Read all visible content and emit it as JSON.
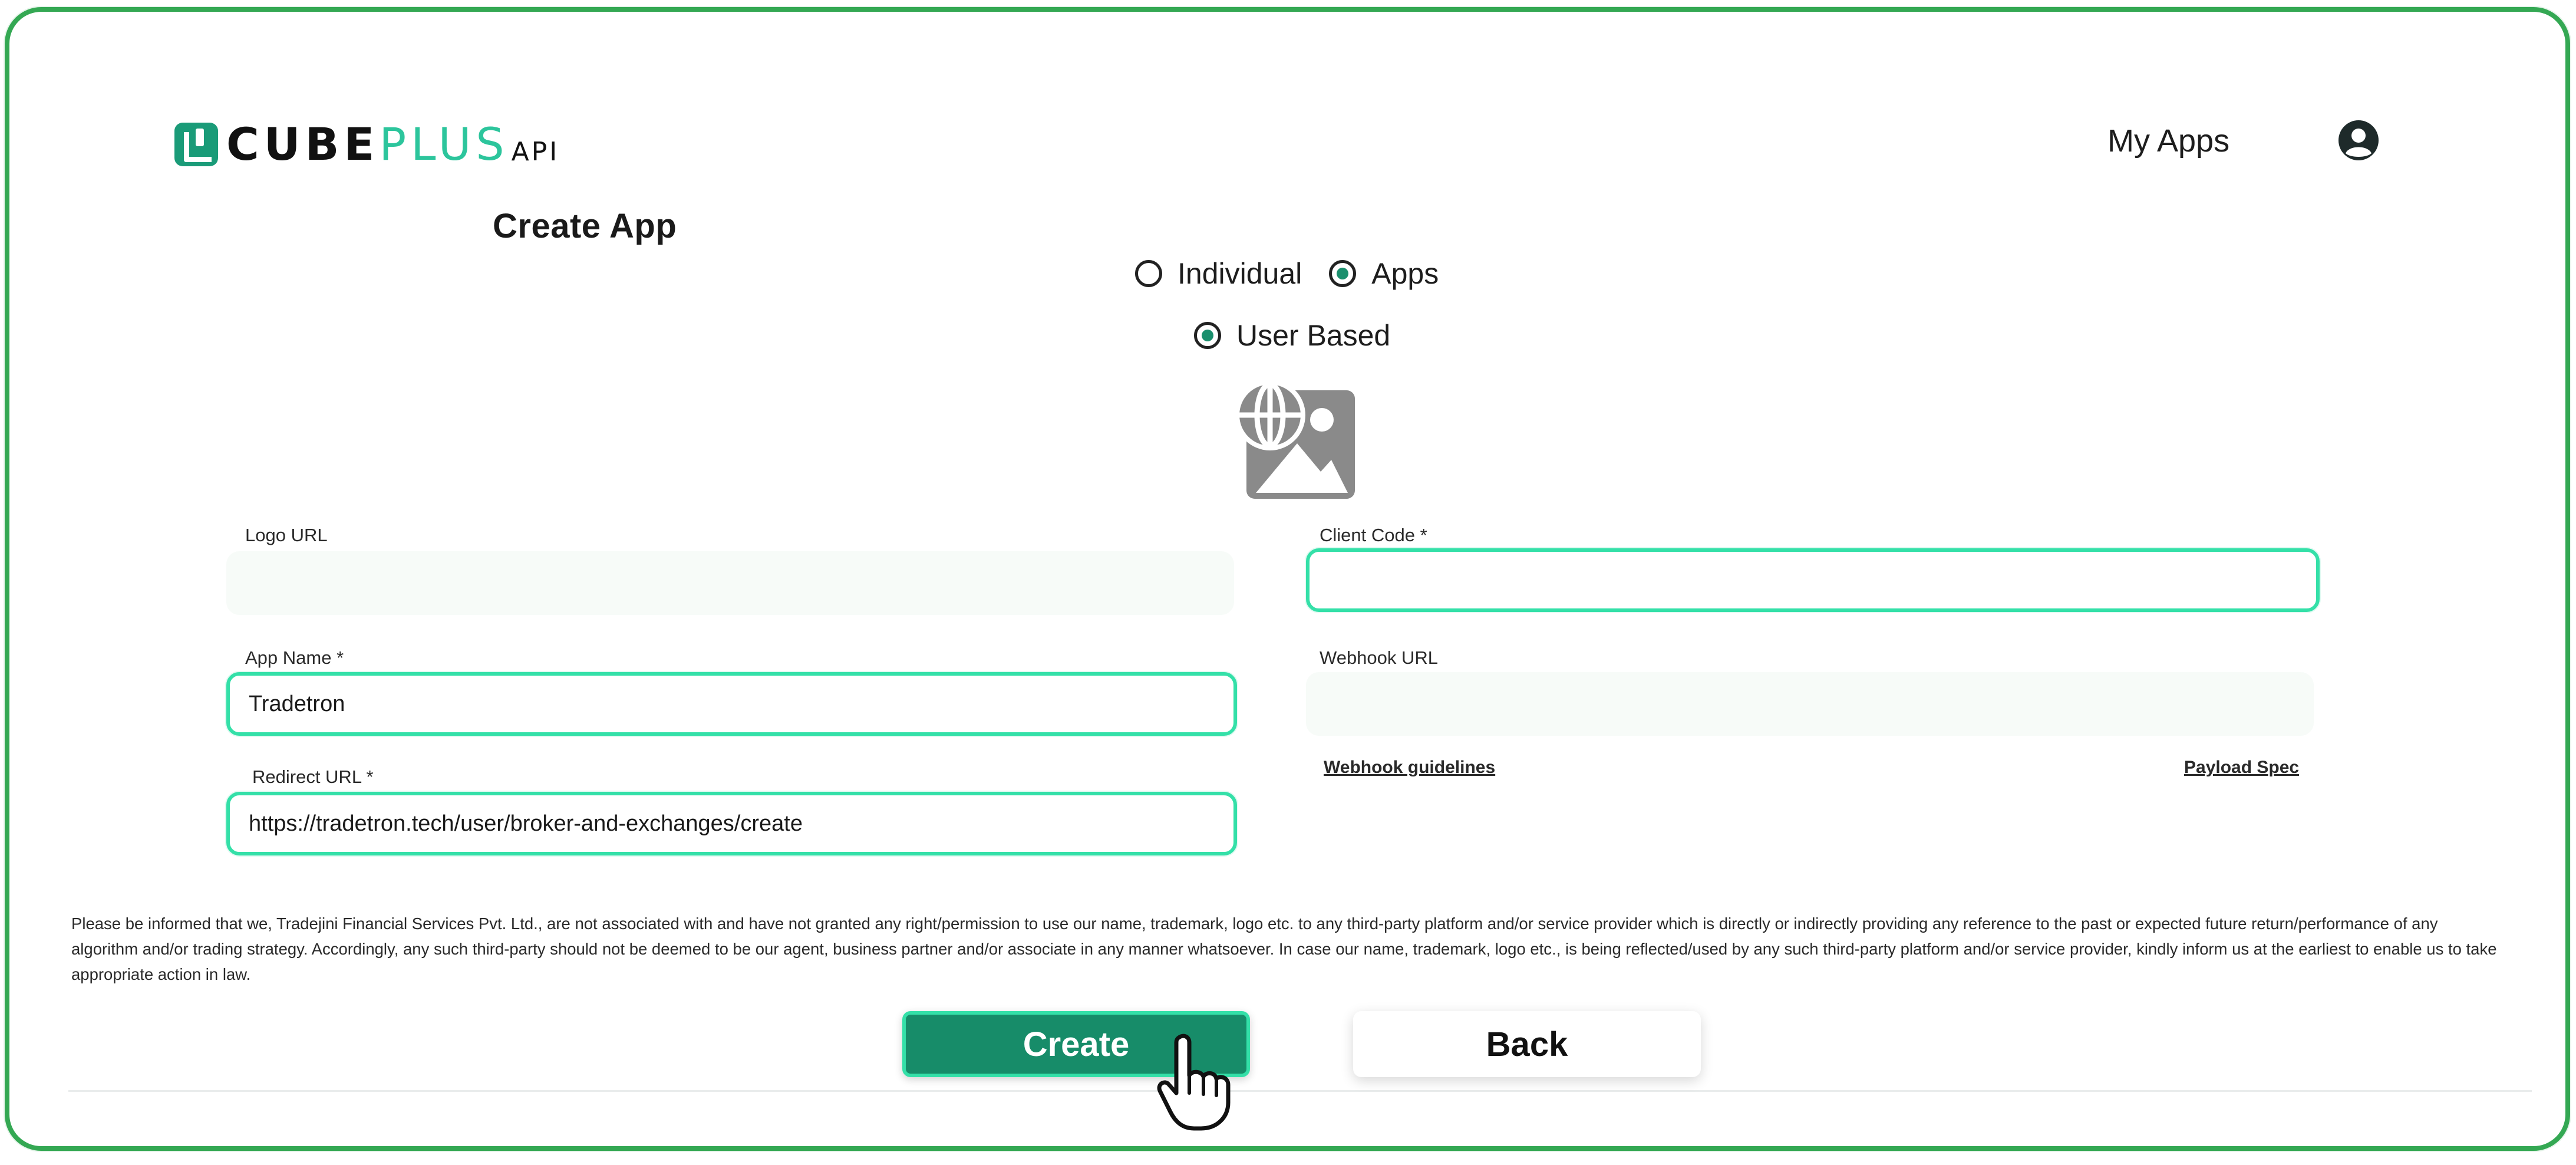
{
  "header": {
    "logo_cube": "CUBE",
    "logo_plus": "PLUS",
    "logo_api": "API",
    "nav_my_apps": "My Apps",
    "user_icon": "user-circle-icon"
  },
  "page_title": "Create App",
  "radios": {
    "individual": {
      "label": "Individual",
      "checked": false
    },
    "apps": {
      "label": "Apps",
      "checked": true
    },
    "user_based": {
      "label": "User Based",
      "checked": true
    }
  },
  "logo_placeholder_icon": "image-web-placeholder-icon",
  "form": {
    "logo_url": {
      "label": "Logo URL",
      "value": ""
    },
    "client_code": {
      "label": "Client Code  *",
      "value": ""
    },
    "app_name": {
      "label": "App Name  *",
      "value": "Tradetron"
    },
    "webhook_url": {
      "label": "Webhook URL",
      "value": ""
    },
    "redirect_url": {
      "label": "Redirect URL  *",
      "value": "https://tradetron.tech/user/broker-and-exchanges/create"
    }
  },
  "links": {
    "webhook_guidelines": "Webhook guidelines",
    "payload_spec": "Payload Spec"
  },
  "disclaimer": "Please be informed that we, Tradejini Financial Services Pvt. Ltd., are not associated with and have not granted any right/permission to use our name, trademark, logo etc. to any third-party platform and/or service provider which is directly or indirectly providing any reference to the past or expected future return/performance of any algorithm and/or trading strategy. Accordingly, any such third-party should not be deemed to be our agent, business partner and/or associate in any manner whatsoever. In case our name, trademark, logo etc., is being reflected/used by any such third-party platform and/or service provider, kindly inform us at the earliest to enable us to take appropriate action in law.",
  "buttons": {
    "create": "Create",
    "back": "Back"
  },
  "cursor_icon": "hand-pointer-icon",
  "colors": {
    "accent": "#178c69",
    "focus_border": "#34e0a8",
    "frame": "#34a853",
    "brand_plus": "#2cc59c"
  }
}
